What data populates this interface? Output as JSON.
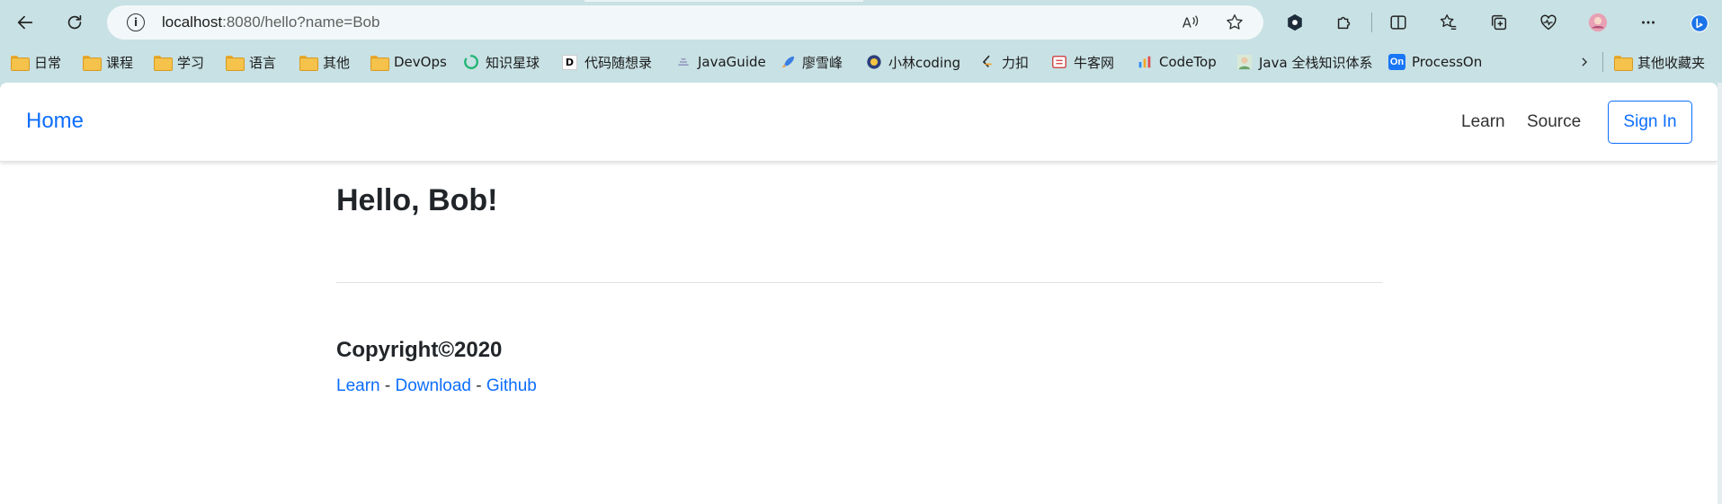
{
  "browser": {
    "url_host": "localhost",
    "url_rest": ":8080/hello?name=Bob",
    "bookmarks": [
      {
        "label": "日常",
        "icon": "folder-icon"
      },
      {
        "label": "课程",
        "icon": "folder-icon"
      },
      {
        "label": "学习",
        "icon": "folder-icon"
      },
      {
        "label": "语言",
        "icon": "folder-icon"
      },
      {
        "label": "其他",
        "icon": "folder-icon"
      },
      {
        "label": "DevOps",
        "icon": "folder-icon"
      },
      {
        "label": "知识星球",
        "icon": "zsxq-icon"
      },
      {
        "label": "代码随想录",
        "icon": "dmsxl-icon"
      },
      {
        "label": "JavaGuide",
        "icon": "javaguide-icon"
      },
      {
        "label": "廖雪峰",
        "icon": "rocket-icon"
      },
      {
        "label": "小林coding",
        "icon": "xiaolin-icon"
      },
      {
        "label": "力扣",
        "icon": "leetcode-icon"
      },
      {
        "label": "牛客网",
        "icon": "nowcoder-icon"
      },
      {
        "label": "CodeTop",
        "icon": "codetop-icon"
      },
      {
        "label": "Java 全栈知识体系",
        "icon": "avatar-icon"
      },
      {
        "label": "ProcessOn",
        "icon": "processon-icon"
      }
    ],
    "other_bookmarks": "其他收藏夹",
    "processon_badge": "On",
    "dmsxl_badge": "D"
  },
  "navbar": {
    "brand": "Home",
    "links": [
      "Learn",
      "Source"
    ],
    "signin": "Sign In"
  },
  "main": {
    "greeting": "Hello, Bob!"
  },
  "footer": {
    "copyright": "Copyright©2020",
    "links": [
      "Learn",
      "Download",
      "Github"
    ],
    "separator": " - "
  },
  "colors": {
    "chrome_bg": "#c8e1e4",
    "link_blue": "#0d6efd",
    "text_dark": "#212529"
  }
}
